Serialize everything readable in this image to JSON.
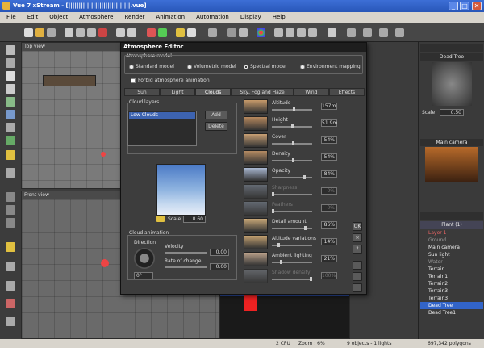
{
  "window": {
    "title": "Vue 7 xStream - [||||||||||||||||||||||||||||||.vue]",
    "min": "_",
    "max": "□",
    "close": "✕"
  },
  "menu": [
    "File",
    "Edit",
    "Object",
    "Atmosphere",
    "Render",
    "Animation",
    "Automation",
    "Display",
    "Help"
  ],
  "viewports": {
    "top": "Top view",
    "front": "Front view"
  },
  "dialog": {
    "title": "Atmosphere Editor",
    "model_label": "Atmosphere model",
    "models": [
      {
        "label": "Standard model",
        "selected": false
      },
      {
        "label": "Volumetric model",
        "selected": false
      },
      {
        "label": "Spectral model",
        "selected": true
      },
      {
        "label": "Environment mapping",
        "selected": false
      }
    ],
    "forbid_label": "Forbid atmosphere animation",
    "tabs": [
      {
        "label": "Sun",
        "active": false
      },
      {
        "label": "Light",
        "active": false
      },
      {
        "label": "Clouds",
        "active": true
      },
      {
        "label": "Sky, Fog and Haze",
        "active": false
      },
      {
        "label": "Wind",
        "active": false
      },
      {
        "label": "Effects",
        "active": false
      }
    ],
    "cloud_layers_label": "Cloud layers",
    "layer_name": "Low Clouds",
    "add": "Add",
    "delete": "Delete",
    "scale_label": "Scale",
    "scale_value": "0.60",
    "anim_label": "Cloud animation",
    "direction_label": "Direction",
    "velocity_label": "Velocity",
    "velocity_value": "0.00",
    "rate_label": "Rate of change",
    "rate_value": "0.00",
    "direction_value": "0°",
    "params": [
      {
        "label": "Altitude",
        "value": "157m",
        "level": 0.55,
        "disabled": false
      },
      {
        "label": "Height",
        "value": "51.9m",
        "level": 0.5,
        "disabled": false
      },
      {
        "label": "Cover",
        "value": "54%",
        "level": 0.54,
        "disabled": false
      },
      {
        "label": "Density",
        "value": "54%",
        "level": 0.54,
        "disabled": false
      },
      {
        "label": "Opacity",
        "value": "84%",
        "level": 0.84,
        "disabled": false
      },
      {
        "label": "Sharpness",
        "value": "0%",
        "level": 0.0,
        "disabled": true
      },
      {
        "label": "Feathers",
        "value": "0%",
        "level": 0.0,
        "disabled": true
      },
      {
        "label": "Detail amount",
        "value": "86%",
        "level": 0.86,
        "disabled": false
      },
      {
        "label": "Altitude variations",
        "value": "14%",
        "level": 0.14,
        "disabled": false
      },
      {
        "label": "Ambient lighting",
        "value": "21%",
        "level": 0.21,
        "disabled": false
      },
      {
        "label": "Shadow density",
        "value": "100%",
        "level": 1.0,
        "disabled": true
      }
    ],
    "ok": "OK",
    "cancel": "✕",
    "help": "?"
  },
  "right": {
    "object_name": "Dead Tree",
    "scale_label": "Scale",
    "scale_value": "0.50",
    "camera_name": "Main camera",
    "tree_header": "Plant (1)",
    "tree": [
      {
        "label": "Layer 1",
        "style": "red"
      },
      {
        "label": "Ground",
        "style": "dim"
      },
      {
        "label": "Main camera",
        "style": ""
      },
      {
        "label": "Sun light",
        "style": ""
      },
      {
        "label": "Water",
        "style": "dim"
      },
      {
        "label": "Terrain",
        "style": ""
      },
      {
        "label": "Terrain1",
        "style": ""
      },
      {
        "label": "Terrain2",
        "style": ""
      },
      {
        "label": "Terrain3",
        "style": ""
      },
      {
        "label": "Terrain3",
        "style": ""
      },
      {
        "label": "Dead Tree",
        "style": "sel"
      },
      {
        "label": "Dead Tree1",
        "style": ""
      }
    ]
  },
  "status": {
    "cpu": "2 CPU",
    "zoom": "Zoom : 6%",
    "objects": "9 objects - 1 lights",
    "polygons": "697,342 polygons"
  },
  "colors": {
    "accent": "#3264c8",
    "titlebar": "#2856b8",
    "dialog_bg": "#3d3d3d"
  }
}
